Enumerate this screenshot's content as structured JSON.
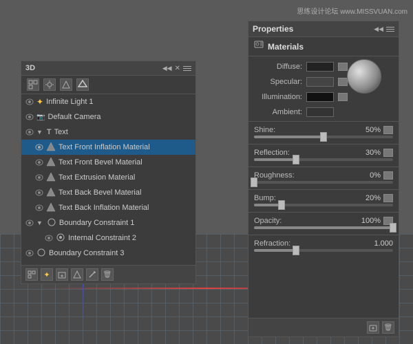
{
  "watermark": "思练设计论坛 www.MISSVUAN.com",
  "panel3d": {
    "title": "3D",
    "layers": [
      {
        "id": "infinite-light",
        "name": "Infinite Light 1",
        "indent": 0,
        "icon": "sun",
        "visible": true,
        "selected": false
      },
      {
        "id": "default-camera",
        "name": "Default Camera",
        "indent": 0,
        "icon": "camera",
        "visible": true,
        "selected": false
      },
      {
        "id": "text",
        "name": "Text",
        "indent": 0,
        "icon": "text",
        "visible": true,
        "selected": false,
        "expanded": true
      },
      {
        "id": "text-front-inflation",
        "name": "Text Front Inflation Material",
        "indent": 1,
        "icon": "material",
        "visible": true,
        "selected": true
      },
      {
        "id": "text-front-bevel",
        "name": "Text Front Bevel Material",
        "indent": 1,
        "icon": "material",
        "visible": true,
        "selected": false
      },
      {
        "id": "text-extrusion",
        "name": "Text Extrusion Material",
        "indent": 1,
        "icon": "material",
        "visible": true,
        "selected": false
      },
      {
        "id": "text-back-bevel",
        "name": "Text Back Bevel Material",
        "indent": 1,
        "icon": "material",
        "visible": true,
        "selected": false
      },
      {
        "id": "text-back-inflation",
        "name": "Text Back Inflation Material",
        "indent": 1,
        "icon": "material",
        "visible": true,
        "selected": false
      },
      {
        "id": "boundary-1",
        "name": "Boundary Constraint 1",
        "indent": 0,
        "icon": "constraint",
        "visible": true,
        "selected": false,
        "expanded": true
      },
      {
        "id": "internal-2",
        "name": "Internal Constraint 2",
        "indent": 2,
        "icon": "constraint-inner",
        "visible": true,
        "selected": false
      },
      {
        "id": "boundary-3",
        "name": "Boundary Constraint 3",
        "indent": 0,
        "icon": "constraint",
        "visible": true,
        "selected": false
      }
    ],
    "toolbar_bottom": [
      "scene",
      "light",
      "new",
      "material",
      "constraint",
      "delete"
    ]
  },
  "props": {
    "title": "Properties",
    "tab": "Materials",
    "colors": {
      "diffuse_label": "Diffuse:",
      "specular_label": "Specular:",
      "illumination_label": "Illumination:",
      "ambient_label": "Ambient:"
    },
    "sliders": [
      {
        "id": "shine",
        "label": "Shine:",
        "value": "50%",
        "percent": 50
      },
      {
        "id": "reflection",
        "label": "Reflection:",
        "value": "30%",
        "percent": 30
      },
      {
        "id": "roughness",
        "label": "Roughness:",
        "value": "0%",
        "percent": 0
      },
      {
        "id": "bump",
        "label": "Bump:",
        "value": "20%",
        "percent": 20
      },
      {
        "id": "opacity",
        "label": "Opacity:",
        "value": "100%",
        "percent": 100
      },
      {
        "id": "refraction",
        "label": "Refraction:",
        "value": "1.000",
        "percent": 30
      }
    ]
  },
  "colors": {
    "panel_bg": "#3c3c3c",
    "header_bg": "#444444",
    "selected_bg": "#1e5a8a",
    "accent": "#4488cc"
  }
}
